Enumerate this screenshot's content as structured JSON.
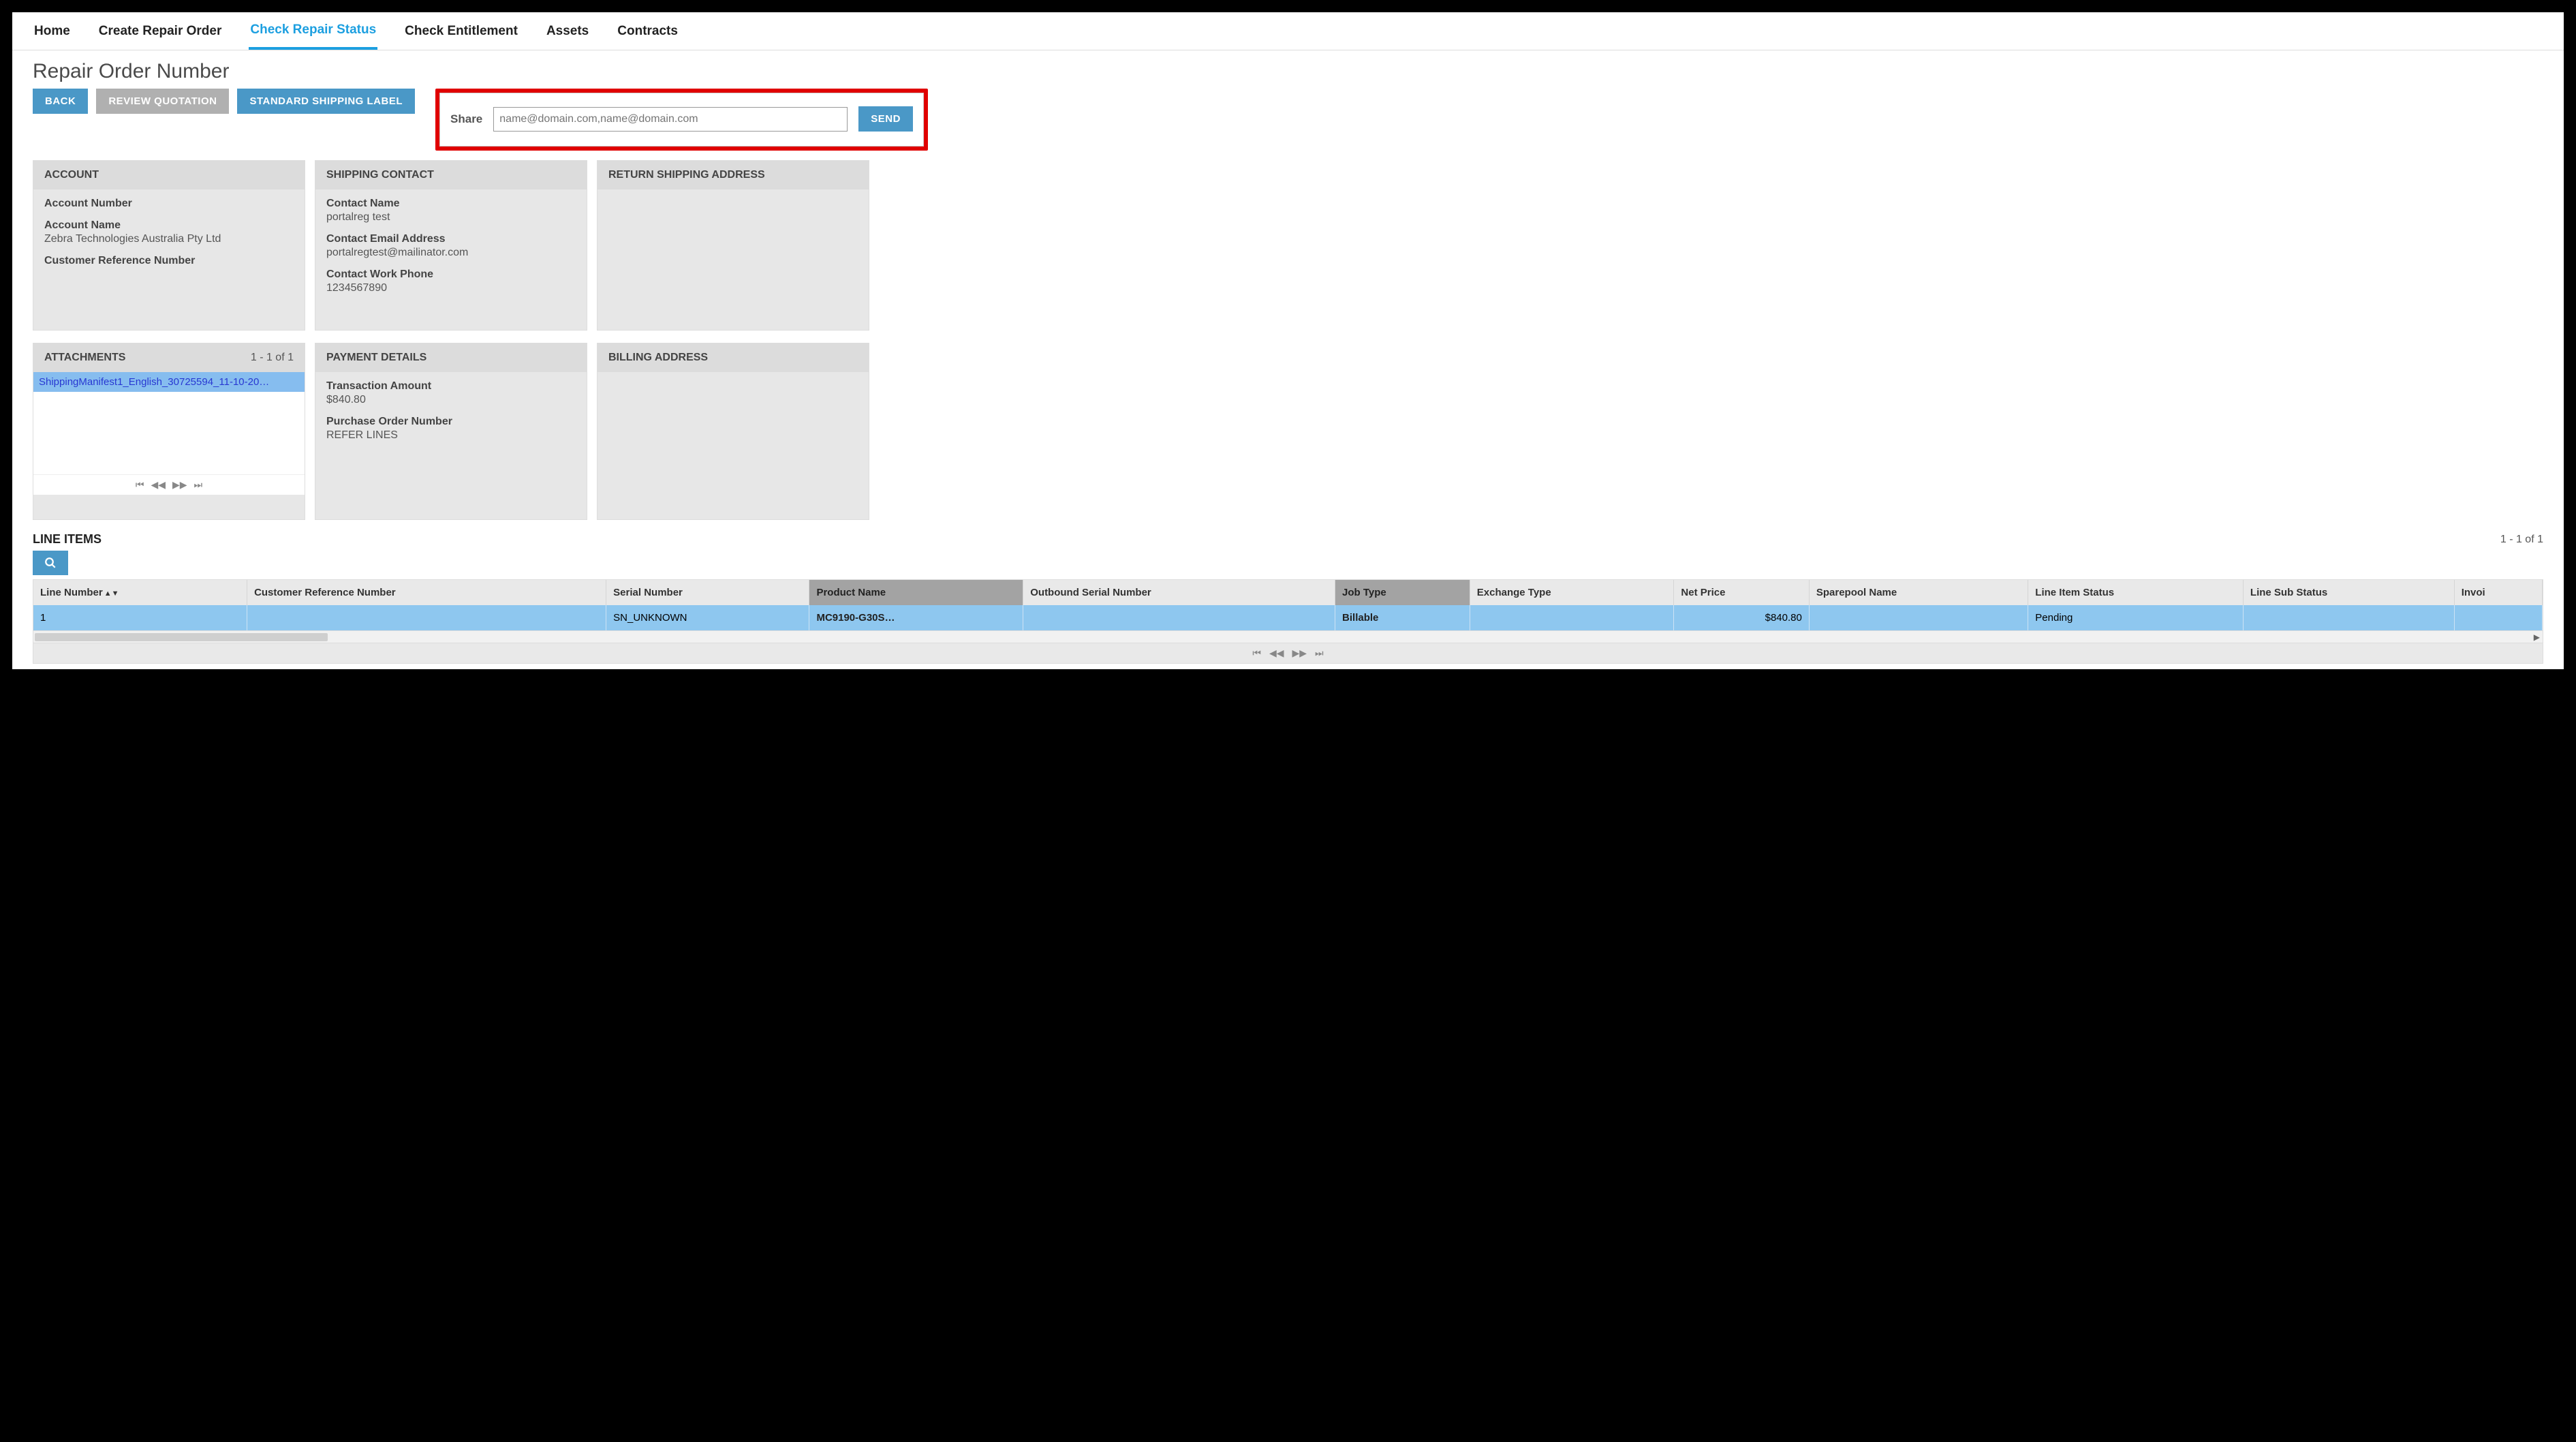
{
  "tabs": {
    "home": "Home",
    "create": "Create Repair Order",
    "status": "Check Repair Status",
    "entitlement": "Check Entitlement",
    "assets": "Assets",
    "contracts": "Contracts"
  },
  "page_title": "Repair Order Number",
  "buttons": {
    "back": "BACK",
    "review": "REVIEW QUOTATION",
    "ship_label": "STANDARD SHIPPING LABEL",
    "send": "SEND"
  },
  "share": {
    "label": "Share",
    "placeholder": "name@domain.com,name@domain.com"
  },
  "account": {
    "header": "ACCOUNT",
    "number_label": "Account Number",
    "number_value": "",
    "name_label": "Account Name",
    "name_value": "Zebra Technologies Australia Pty Ltd",
    "cust_ref_label": "Customer Reference Number",
    "cust_ref_value": ""
  },
  "shipping_contact": {
    "header": "SHIPPING CONTACT",
    "name_label": "Contact Name",
    "name_value": "portalreg test",
    "email_label": "Contact Email Address",
    "email_value": "portalregtest@mailinator.com",
    "phone_label": "Contact Work Phone",
    "phone_value": "1234567890"
  },
  "return_shipping": {
    "header": "RETURN SHIPPING ADDRESS"
  },
  "attachments": {
    "header": "ATTACHMENTS",
    "count": "1 - 1 of 1",
    "row0": "ShippingManifest1_English_30725594_11-10-20…"
  },
  "payment": {
    "header": "PAYMENT DETAILS",
    "amount_label": "Transaction Amount",
    "amount_value": "$840.80",
    "po_label": "Purchase Order Number",
    "po_value": "REFER LINES"
  },
  "billing": {
    "header": "BILLING ADDRESS"
  },
  "line_items": {
    "title": "LINE ITEMS",
    "count": "1 - 1 of 1",
    "columns": {
      "line_no": "Line Number",
      "cust_ref": "Customer Reference Number",
      "serial": "Serial Number",
      "product": "Product Name",
      "out_serial": "Outbound Serial Number",
      "job_type": "Job Type",
      "exchange": "Exchange Type",
      "net_price": "Net Price",
      "sparepool": "Sparepool Name",
      "status": "Line Item Status",
      "sub_status": "Line Sub Status",
      "invoice": "Invoi"
    },
    "rows": [
      {
        "line_no": "1",
        "cust_ref": "",
        "serial": "SN_UNKNOWN",
        "product": "MC9190-G30S…",
        "out_serial": "",
        "job_type": "Billable",
        "exchange": "",
        "net_price": "$840.80",
        "sparepool": "",
        "status": "Pending",
        "sub_status": "",
        "invoice": ""
      }
    ]
  },
  "pager_icons": {
    "first": "⏮",
    "prev": "◀◀",
    "next": "▶▶",
    "last": "⏭"
  }
}
